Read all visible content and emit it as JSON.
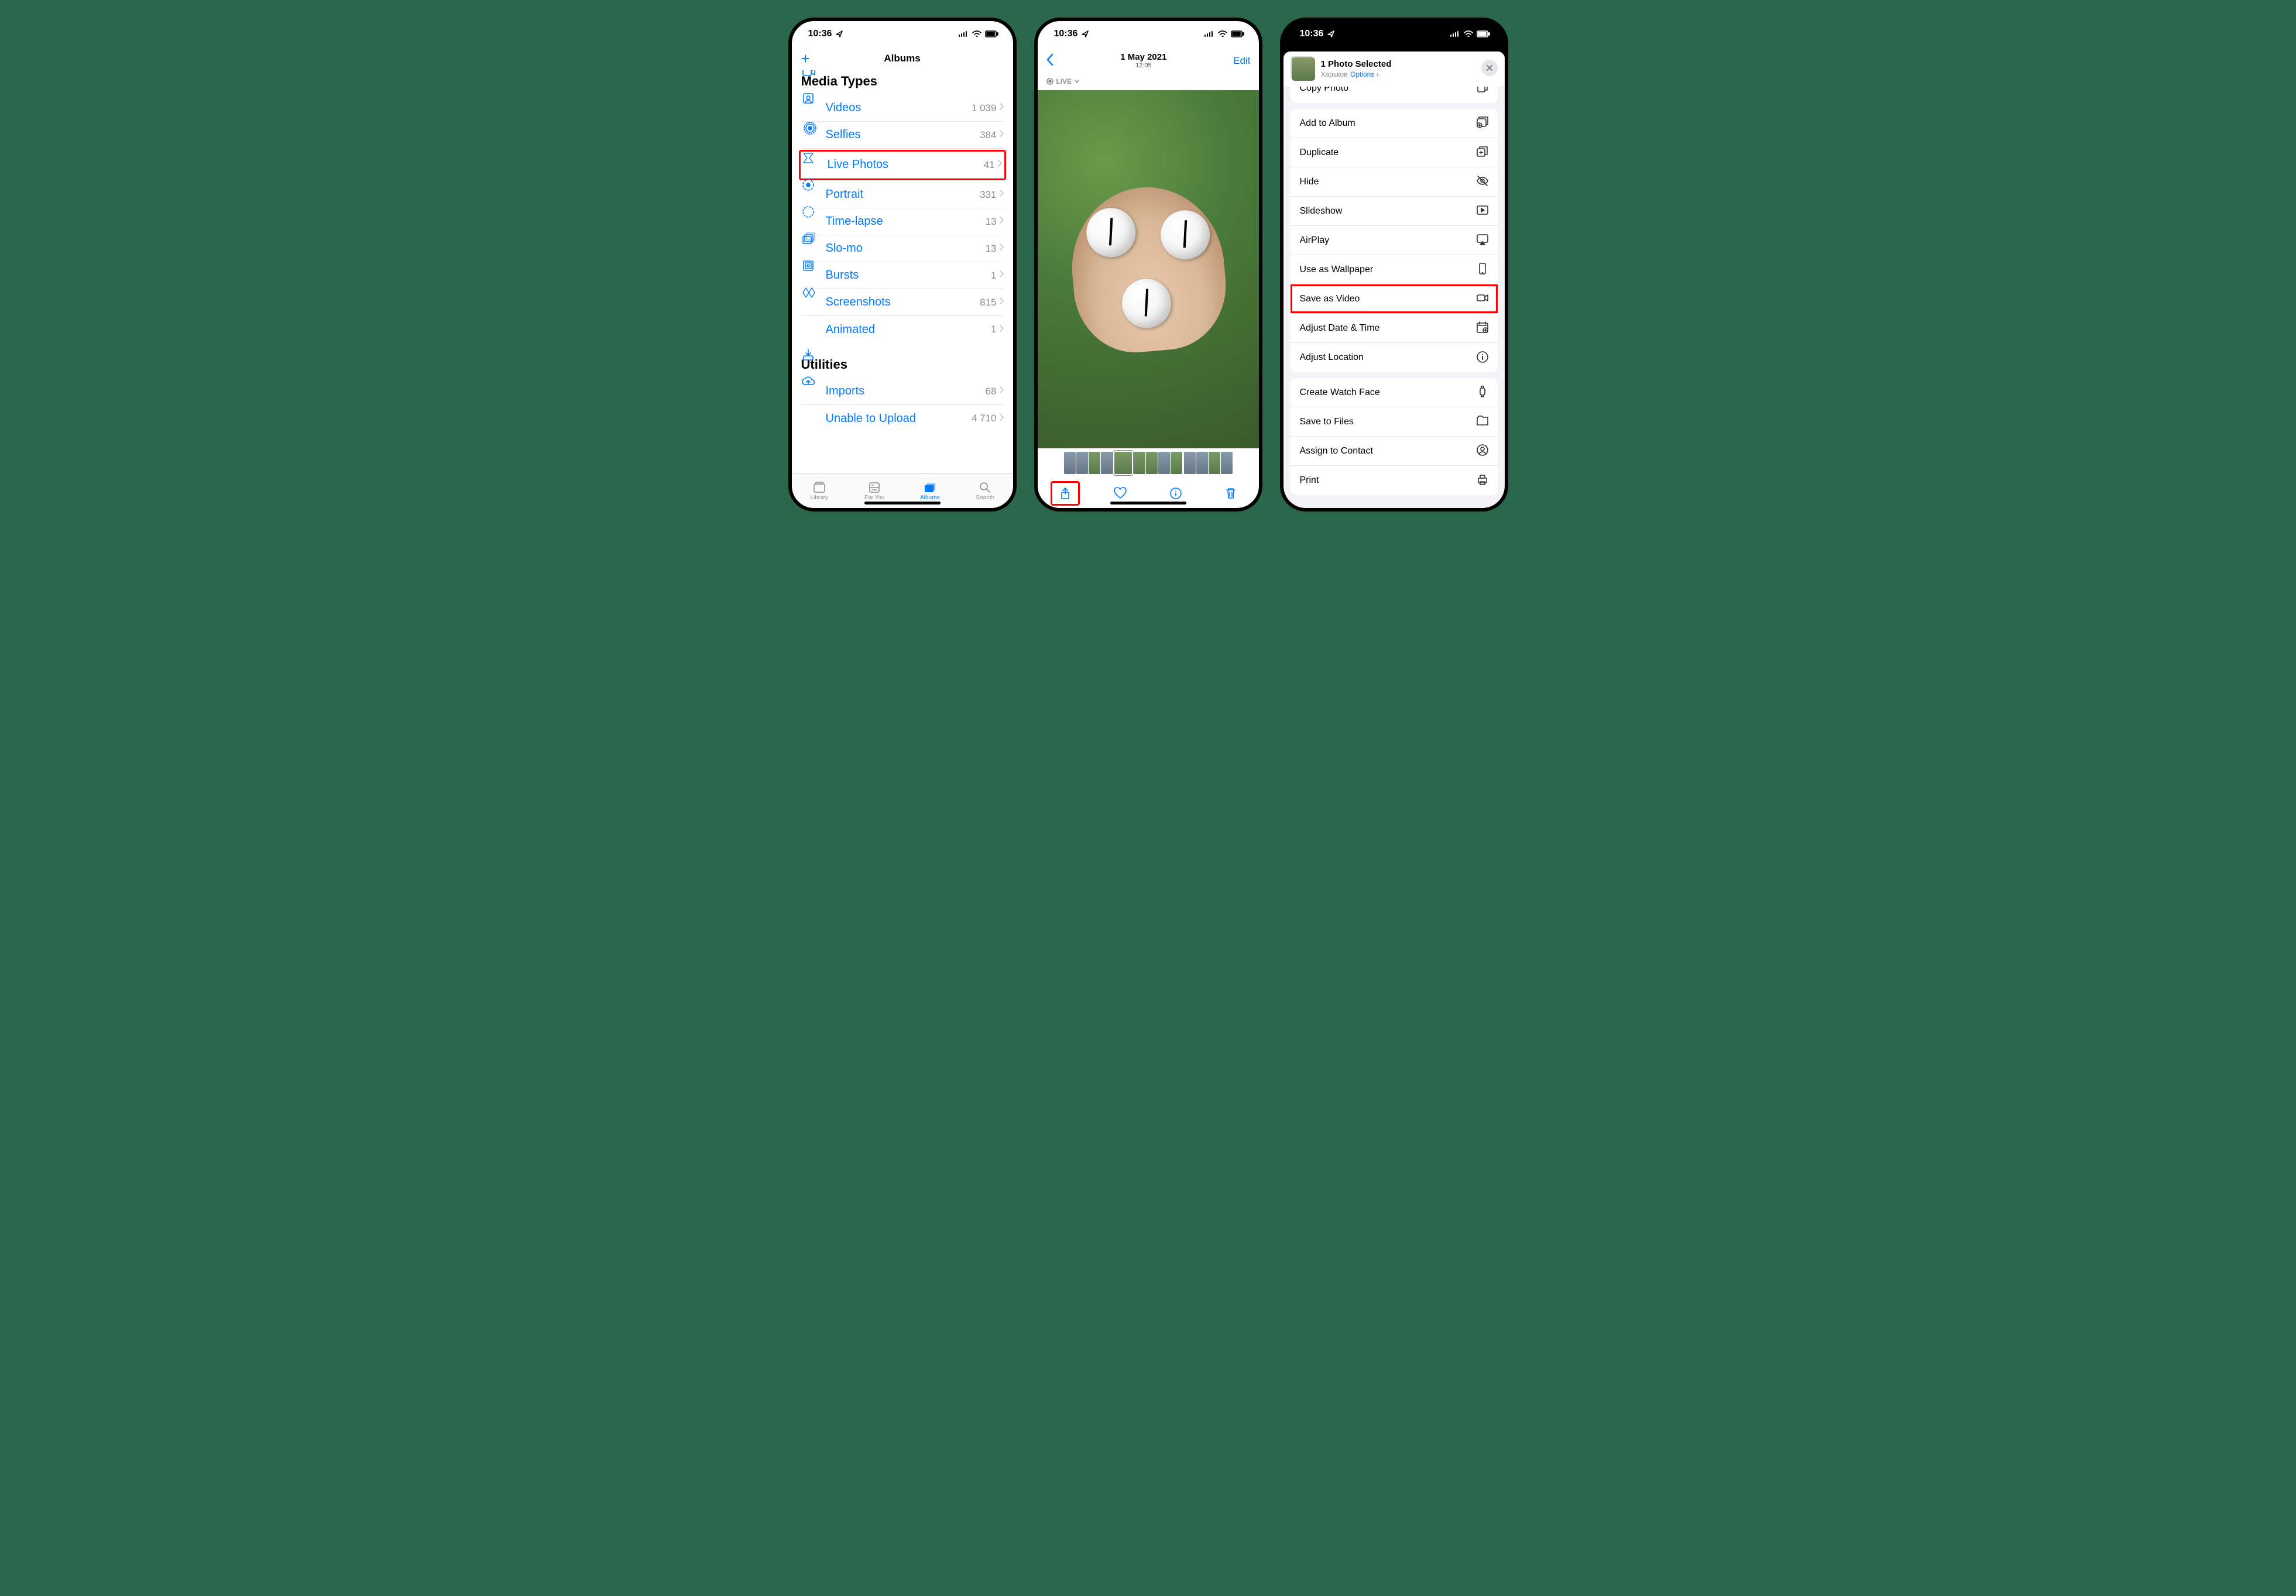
{
  "status": {
    "time": "10:36"
  },
  "screen1": {
    "nav_title": "Albums",
    "section_media": "Media Types",
    "section_util": "Utilities",
    "media_items": [
      {
        "icon": "video",
        "label": "Videos",
        "count": "1 039"
      },
      {
        "icon": "selfie",
        "label": "Selfies",
        "count": "384"
      },
      {
        "icon": "live",
        "label": "Live Photos",
        "count": "41",
        "hl": true
      },
      {
        "icon": "portrait",
        "label": "Portrait",
        "count": "331"
      },
      {
        "icon": "timelapse",
        "label": "Time-lapse",
        "count": "13"
      },
      {
        "icon": "slomo",
        "label": "Slo-mo",
        "count": "13"
      },
      {
        "icon": "bursts",
        "label": "Bursts",
        "count": "1"
      },
      {
        "icon": "screenshot",
        "label": "Screenshots",
        "count": "815"
      },
      {
        "icon": "animated",
        "label": "Animated",
        "count": "1"
      }
    ],
    "util_items": [
      {
        "icon": "imports",
        "label": "Imports",
        "count": "68"
      },
      {
        "icon": "upload",
        "label": "Unable to Upload",
        "count": "4 710"
      }
    ],
    "tabs": [
      {
        "label": "Library"
      },
      {
        "label": "For You"
      },
      {
        "label": "Albums",
        "active": true
      },
      {
        "label": "Search"
      }
    ]
  },
  "screen2": {
    "date": "1 May 2021",
    "time": "12:05",
    "edit": "Edit",
    "live": "LIVE"
  },
  "screen3": {
    "title": "1 Photo Selected",
    "location": "Харьков",
    "options": "Options",
    "peek": "Copy Photo",
    "group1": [
      {
        "label": "Add to Album",
        "icon": "addalbum"
      },
      {
        "label": "Duplicate",
        "icon": "duplicate"
      },
      {
        "label": "Hide",
        "icon": "hide"
      },
      {
        "label": "Slideshow",
        "icon": "slideshow"
      },
      {
        "label": "AirPlay",
        "icon": "airplay"
      },
      {
        "label": "Use as Wallpaper",
        "icon": "wallpaper"
      },
      {
        "label": "Save as Video",
        "icon": "savevideo",
        "hl": true
      },
      {
        "label": "Adjust Date & Time",
        "icon": "adjdate"
      },
      {
        "label": "Adjust Location",
        "icon": "adjloc"
      }
    ],
    "group2": [
      {
        "label": "Create Watch Face",
        "icon": "watch"
      },
      {
        "label": "Save to Files",
        "icon": "files"
      },
      {
        "label": "Assign to Contact",
        "icon": "contact"
      },
      {
        "label": "Print",
        "icon": "print"
      }
    ]
  }
}
